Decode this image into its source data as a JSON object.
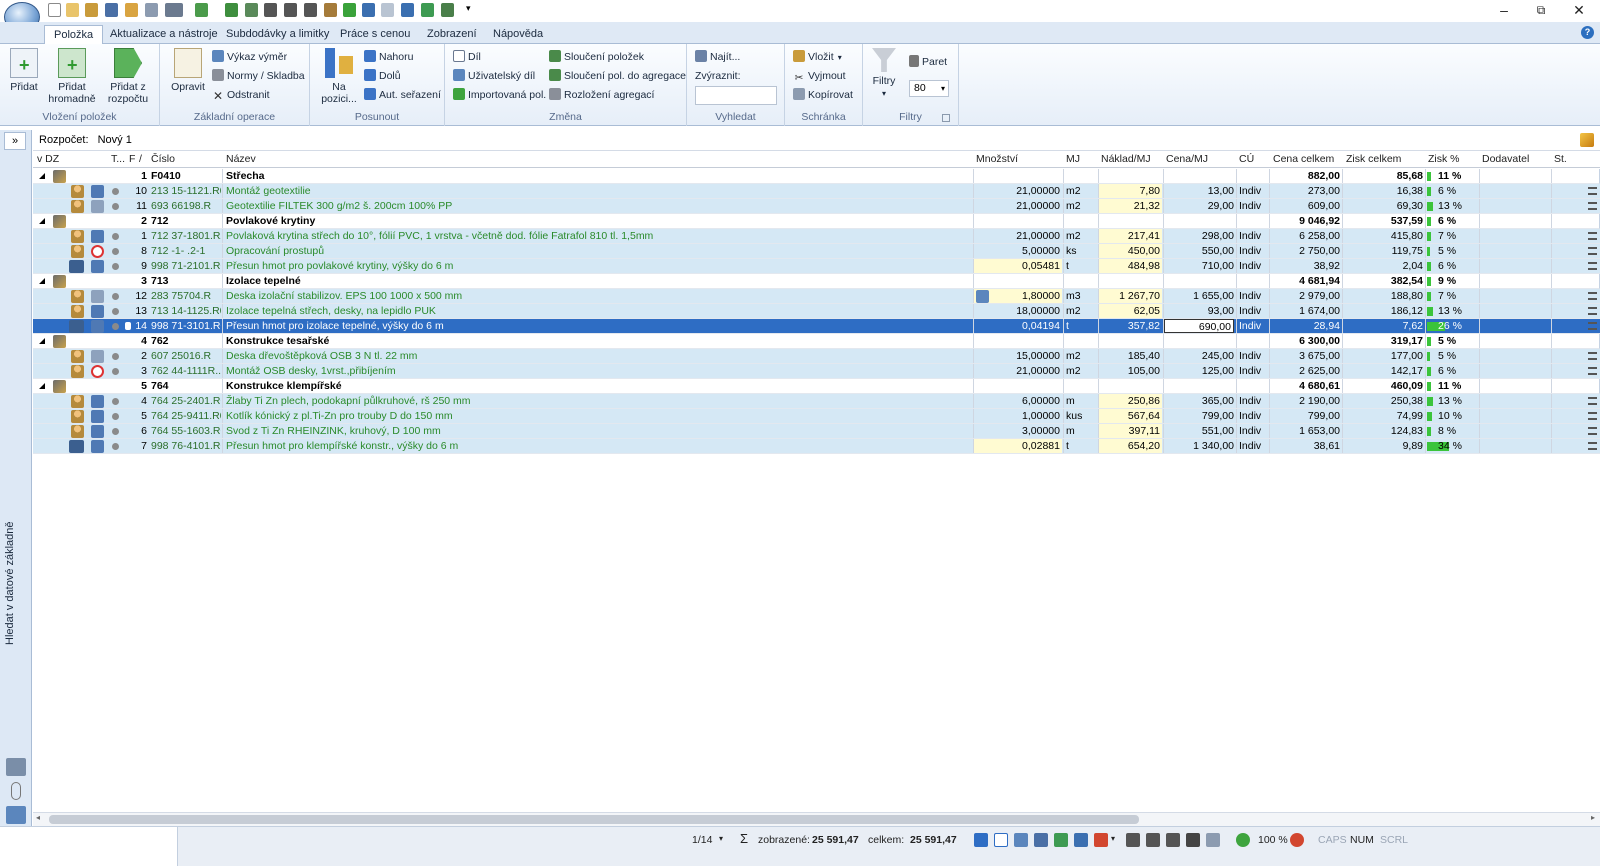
{
  "ribbon": {
    "tabs": [
      "Položka",
      "Aktualizace a nástroje",
      "Subdodávky a limitky",
      "Práce s cenou",
      "Zobrazení",
      "Nápověda"
    ],
    "groups": {
      "vlozeni": {
        "label": "Vložení položek",
        "pridat": "Přidat",
        "hromadne_1": "Přidat",
        "hromadne_2": "hromadně",
        "zrozpoctu_1": "Přidat z",
        "zrozpoctu_2": "rozpočtu"
      },
      "zakladni": {
        "label": "Základní operace",
        "opravit": "Opravit",
        "vykaz": "Výkaz výměr",
        "normy": "Normy / Skladba",
        "odstranit": "Odstranit"
      },
      "posunout": {
        "label": "Posunout",
        "na_1": "Na",
        "na_2": "pozici...",
        "nahoru": "Nahoru",
        "dolu": "Dolů",
        "aut": "Aut. seřazení"
      },
      "zmena": {
        "label": "Změna",
        "dil": "Díl",
        "uziv": "Uživatelský díl",
        "import": "Importovaná pol.",
        "slouceni": "Sloučení položek",
        "slouceni_agr": "Sloučení pol. do agregace",
        "rozlozeni": "Rozložení agregací"
      },
      "vyhledat": {
        "label": "Vyhledat",
        "najit": "Najít...",
        "zvyraznit": "Zvýraznit:"
      },
      "schranka": {
        "label": "Schránka",
        "vlozit": "Vložit",
        "vyjmout": "Vyjmout",
        "kopirovat": "Kopírovat"
      },
      "filtry": {
        "label": "Filtry",
        "filtry": "Filtry",
        "paret": "Paret",
        "paret_value": "80"
      }
    }
  },
  "side": {
    "label": "Hledat v datové základně"
  },
  "breadcrumb": {
    "label": "Rozpočet:",
    "value": "Nový 1"
  },
  "columns": [
    "v DZ",
    "T...",
    "F",
    "/",
    "Číslo",
    "Název",
    "Množství",
    "MJ",
    "Náklad/MJ",
    "Cena/MJ",
    "CÚ",
    "Cena celkem",
    "Zisk celkem",
    "Zisk %",
    "Dodavatel",
    "St."
  ],
  "rows": [
    {
      "type": "group",
      "n": "1",
      "cislo": "F0410",
      "nazev": "Střecha",
      "cena": "882,00",
      "zisk": "85,68",
      "pct": "11 %",
      "bar": 0
    },
    {
      "type": "item",
      "n": "10",
      "cislo": "213 15-1121.R00",
      "nazev": "Montáž geotextilie",
      "mn": "21,00000",
      "mj": "m2",
      "nak": "7,80",
      "cmj": "13,00",
      "cu": "Indiv",
      "cena": "273,00",
      "zisk": "16,38",
      "pct": "6 %",
      "bar": 4,
      "who": "db",
      "nakyel": true
    },
    {
      "type": "item",
      "n": "11",
      "cislo": "693 66198.R",
      "nazev": "Geotextilie FILTEK 300 g/m2 š. 200cm 100% PP",
      "mn": "21,00000",
      "mj": "m2",
      "nak": "21,32",
      "cmj": "29,00",
      "cu": "Indiv",
      "cena": "609,00",
      "zisk": "69,30",
      "pct": "13 %",
      "bar": 6,
      "who": "dbx",
      "nakyel": true
    },
    {
      "type": "group",
      "n": "2",
      "cislo": "712",
      "nazev": "Povlakové krytiny",
      "cena": "9 046,92",
      "zisk": "537,59",
      "pct": "6 %",
      "bar": 0
    },
    {
      "type": "item",
      "n": "1",
      "cislo": "712 37-1801.RZ4",
      "nazev": "Povlaková krytina střech do 10°, fólií PVC, 1 vrstva - včetně dod. fólie Fatrafol 810 tl. 1,5mm",
      "mn": "21,00000",
      "mj": "m2",
      "nak": "217,41",
      "cmj": "298,00",
      "cu": "Indiv",
      "cena": "6 258,00",
      "zisk": "415,80",
      "pct": "7 %",
      "bar": 4,
      "who": "db",
      "nakyel": true
    },
    {
      "type": "item",
      "n": "8",
      "cislo": "712 -1-   .2-1",
      "nazev": "Opracování prostupů",
      "mn": "5,00000",
      "mj": "ks",
      "nak": "450,00",
      "cmj": "550,00",
      "cu": "Indiv",
      "cena": "2 750,00",
      "zisk": "119,75",
      "pct": "5 %",
      "bar": 3,
      "who": "no",
      "nakyel": true
    },
    {
      "type": "item",
      "n": "9",
      "cislo": "998 71-2101.R00",
      "nazev": "Přesun hmot pro povlakové krytiny, výšky do 6 m",
      "mn": "0,05481",
      "mj": "t",
      "nak": "484,98",
      "cmj": "710,00",
      "cu": "Indiv",
      "cena": "38,92",
      "zisk": "2,04",
      "pct": "6 %",
      "bar": 4,
      "who": "truck",
      "mnyel": true,
      "nakyel": true
    },
    {
      "type": "group",
      "n": "3",
      "cislo": "713",
      "nazev": "Izolace tepelné",
      "cena": "4 681,94",
      "zisk": "382,54",
      "pct": "9 %",
      "bar": 0
    },
    {
      "type": "item",
      "n": "12",
      "cislo": "283 75704.R",
      "nazev": "Deska izolační stabilizov. EPS 100  1000 x 500 mm",
      "mn": "1,80000",
      "mj": "m3",
      "nak": "1 267,70",
      "cmj": "1 655,00",
      "cu": "Indiv",
      "cena": "2 979,00",
      "zisk": "188,80",
      "pct": "7 %",
      "bar": 4,
      "who": "dbx",
      "mnyel": true,
      "nakyel": true
    },
    {
      "type": "item",
      "n": "13",
      "cislo": "713 14-1125.R00",
      "nazev": "Izolace tepelná střech, desky, na lepidlo PUK",
      "mn": "18,00000",
      "mj": "m2",
      "nak": "62,05",
      "cmj": "93,00",
      "cu": "Indiv",
      "cena": "1 674,00",
      "zisk": "186,12",
      "pct": "13 %",
      "bar": 6,
      "who": "db",
      "nakyel": true
    },
    {
      "type": "sel",
      "n": "14",
      "cislo": "998 71-3101.R00",
      "nazev": "Přesun hmot pro izolace tepelné, výšky do 6 m",
      "mn": "0,04194",
      "mj": "t",
      "nak": "357,82",
      "cmj": "690,00",
      "cu": "Indiv",
      "cena": "28,94",
      "zisk": "7,62",
      "pct": "26 %",
      "bar": 18,
      "who": "truck"
    },
    {
      "type": "group",
      "n": "4",
      "cislo": "762",
      "nazev": "Konstrukce tesařské",
      "cena": "6 300,00",
      "zisk": "319,17",
      "pct": "5 %",
      "bar": 0
    },
    {
      "type": "item",
      "n": "2",
      "cislo": "607 25016.R",
      "nazev": "Deska dřevoštěpková OSB 3 N tl. 22 mm",
      "mn": "15,00000",
      "mj": "m2",
      "nak": "185,40",
      "cmj": "245,00",
      "cu": "Indiv",
      "cena": "3 675,00",
      "zisk": "177,00",
      "pct": "5 %",
      "bar": 3,
      "who": "dbx"
    },
    {
      "type": "item",
      "n": "3",
      "cislo": "762 44-1111R....",
      "nazev": "Montáž OSB desky, 1vrst.,přibíjením",
      "mn": "21,00000",
      "mj": "m2",
      "nak": "105,00",
      "cmj": "125,00",
      "cu": "Indiv",
      "cena": "2 625,00",
      "zisk": "142,17",
      "pct": "6 %",
      "bar": 4,
      "who": "no"
    },
    {
      "type": "group",
      "n": "5",
      "cislo": "764",
      "nazev": "Konstrukce klempířské",
      "cena": "4 680,61",
      "zisk": "460,09",
      "pct": "11 %",
      "bar": 0
    },
    {
      "type": "item",
      "n": "4",
      "cislo": "764 25-2401.R00",
      "nazev": "Žlaby Ti Zn plech, podokapní půlkruhové, rš 250 mm",
      "mn": "6,00000",
      "mj": "m",
      "nak": "250,86",
      "cmj": "365,00",
      "cu": "Indiv",
      "cena": "2 190,00",
      "zisk": "250,38",
      "pct": "13 %",
      "bar": 6,
      "who": "db",
      "nakyel": true
    },
    {
      "type": "item",
      "n": "5",
      "cislo": "764 25-9411.R00",
      "nazev": "Kotlík kónický z pl.Ti-Zn pro trouby D do 150 mm",
      "mn": "1,00000",
      "mj": "kus",
      "nak": "567,64",
      "cmj": "799,00",
      "cu": "Indiv",
      "cena": "799,00",
      "zisk": "74,99",
      "pct": "10 %",
      "bar": 5,
      "who": "db",
      "nakyel": true
    },
    {
      "type": "item",
      "n": "6",
      "cislo": "764 55-1603.R00",
      "nazev": "Svod z Ti Zn RHEINZINK, kruhový, D 100 mm",
      "mn": "3,00000",
      "mj": "m",
      "nak": "397,11",
      "cmj": "551,00",
      "cu": "Indiv",
      "cena": "1 653,00",
      "zisk": "124,83",
      "pct": "8 %",
      "bar": 4,
      "who": "db",
      "nakyel": true
    },
    {
      "type": "item",
      "n": "7",
      "cislo": "998 76-4101.R00",
      "nazev": "Přesun hmot pro klempířské konstr., výšky do 6 m",
      "mn": "0,02881",
      "mj": "t",
      "nak": "654,20",
      "cmj": "1 340,00",
      "cu": "Indiv",
      "cena": "38,61",
      "zisk": "9,89",
      "pct": "34 %",
      "bar": 22,
      "who": "truck",
      "mnyel": true,
      "nakyel": true
    }
  ],
  "status": {
    "page": "1/14",
    "zobrazene_label": "zobrazené:",
    "zobrazene": "25 591,47",
    "celkem_label": "celkem:",
    "celkem": "25 591,47",
    "zoom": "100 %",
    "caps": "CAPS",
    "num": "NUM",
    "scrl": "SCRL"
  }
}
